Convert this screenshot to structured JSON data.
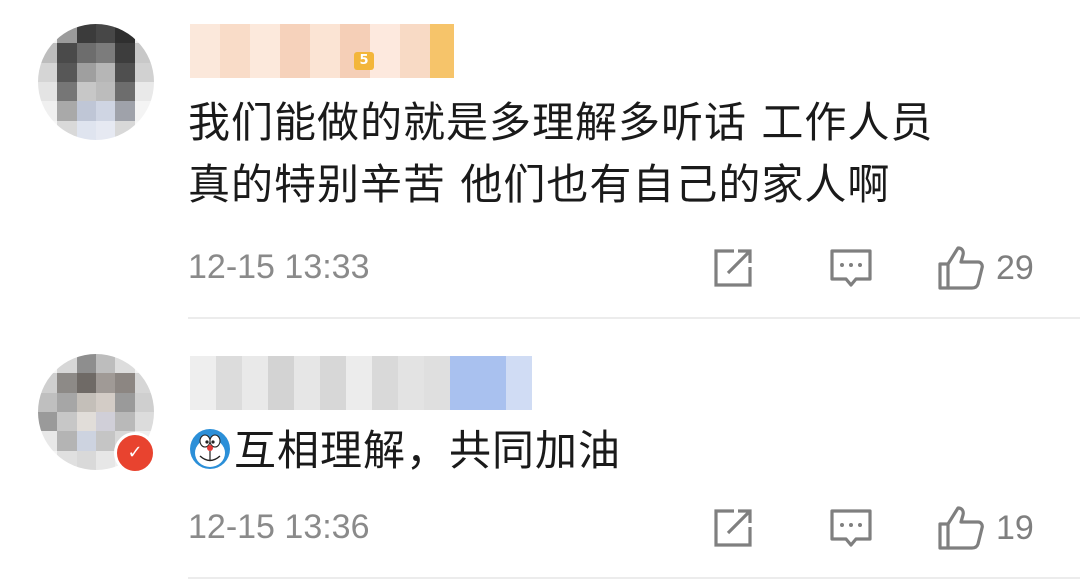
{
  "comments": [
    {
      "text_lines": [
        "我们能做的就是多理解多听话 工作人员",
        "真的特别辛苦 他们也有自己的家人啊"
      ],
      "timestamp": "12-15 13:33",
      "likes": "29",
      "icons": {
        "share": "share-icon",
        "reply": "comment-icon",
        "like": "thumbs-up-icon",
        "badge": "vip-badge"
      }
    },
    {
      "text": "互相理解，共同加油",
      "emoji": "doraemon-emoji",
      "timestamp": "12-15 13:36",
      "likes": "19",
      "icons": {
        "share": "share-icon",
        "reply": "comment-icon",
        "like": "thumbs-up-icon",
        "badge": "red-weibo-badge"
      }
    }
  ],
  "colors": {
    "text": "#1a1a1a",
    "meta": "#8a8a8a",
    "icon": "#7f7f7f",
    "divider": "#ececec",
    "vip_badge": "#f3b63a",
    "red_badge": "#e8432f"
  }
}
